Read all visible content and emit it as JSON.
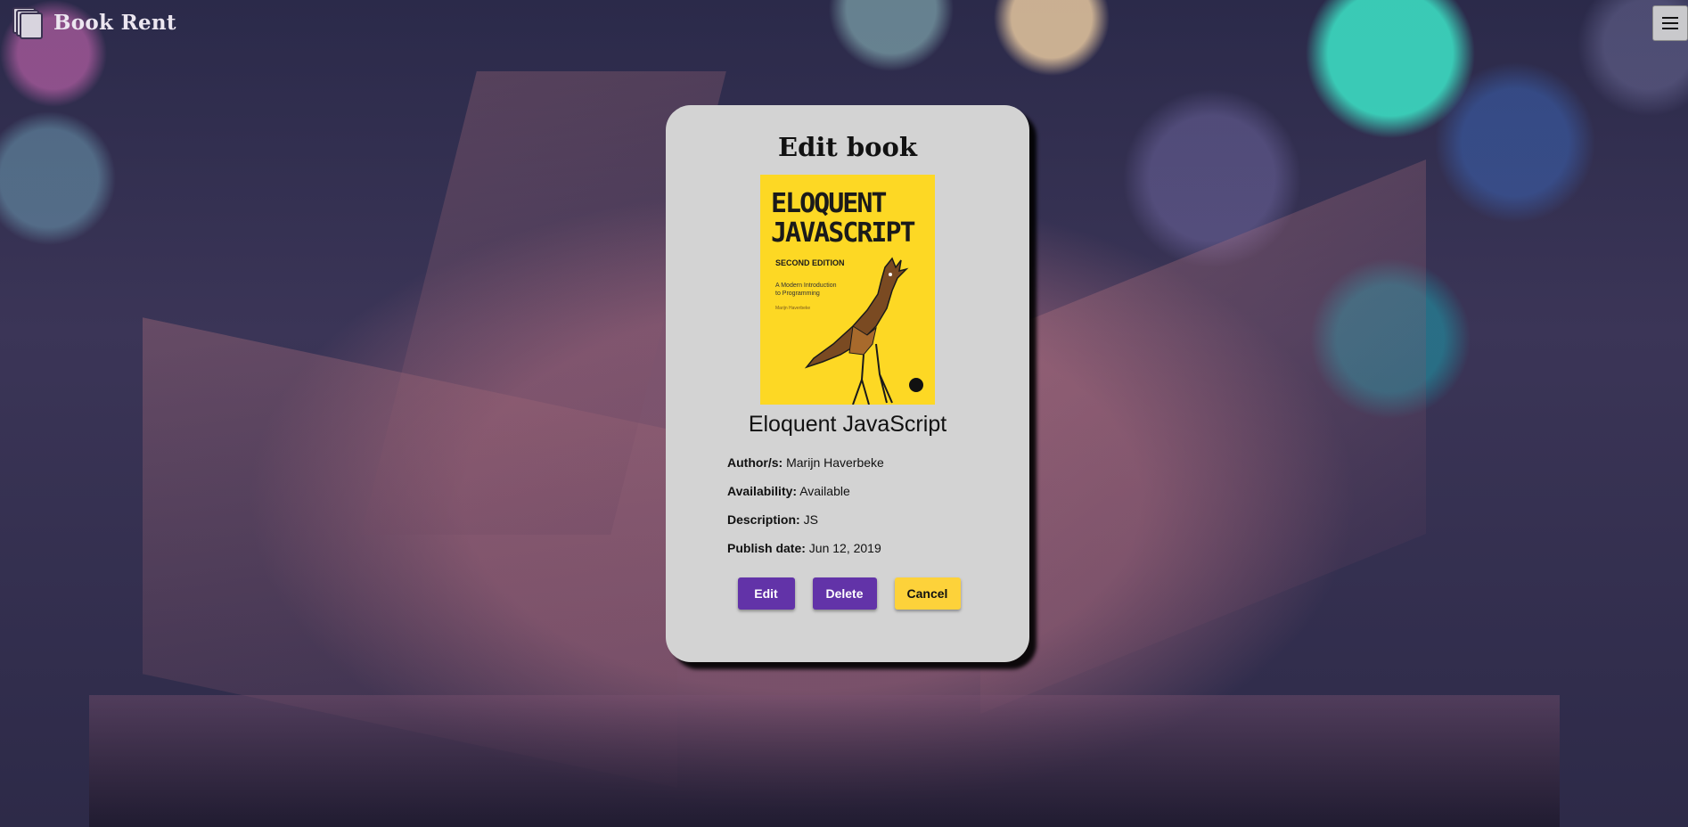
{
  "app": {
    "title": "Book Rent",
    "logo_icon": "stacked-books-icon",
    "menu_icon": "hamburger-menu-icon"
  },
  "card": {
    "title": "Edit book",
    "book_name": "Eloquent JavaScript",
    "cover": {
      "title": "ELOQUENT\nJAVASCRIPT",
      "edition": "SECOND EDITION",
      "subtitle": "A Modern Introduction\nto Programming",
      "author": "Marijn Haverbeke",
      "background_color": "#fdd824"
    },
    "details": [
      {
        "label": "Author/s:",
        "value": "Marijn Haverbeke"
      },
      {
        "label": "Availability:",
        "value": "Available"
      },
      {
        "label": "Description:",
        "value": "JS"
      },
      {
        "label": "Publish date:",
        "value": "Jun 12, 2019"
      }
    ],
    "buttons": {
      "edit": "Edit",
      "delete": "Delete",
      "cancel": "Cancel"
    }
  },
  "colors": {
    "primary": "#6233a8",
    "accent": "#fdd23a",
    "card_background": "#d3d3d3"
  }
}
